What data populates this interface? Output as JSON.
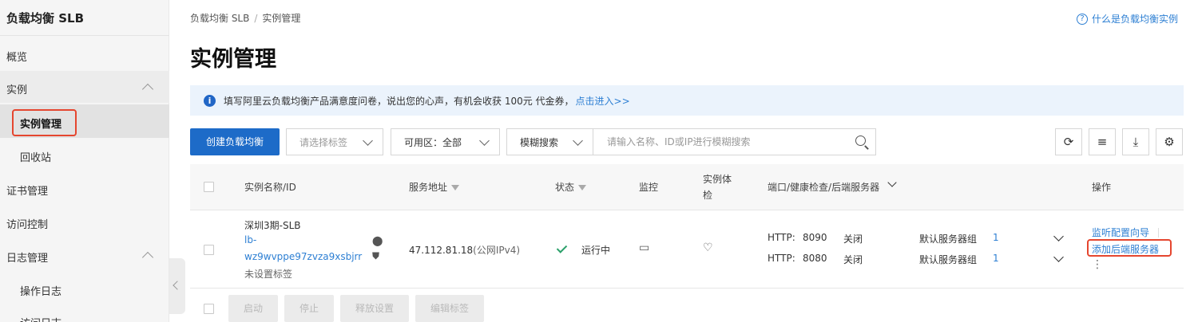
{
  "sidebar": {
    "title": "负载均衡 SLB",
    "items": {
      "overview": "概览",
      "instances": "实例",
      "instance_mgmt": "实例管理",
      "recycle": "回收站",
      "certs": "证书管理",
      "access": "访问控制",
      "logs": "日志管理",
      "op_logs": "操作日志",
      "access_logs": "访问日志"
    }
  },
  "breadcrumb": {
    "root": "负载均衡 SLB",
    "sep": "/",
    "current": "实例管理"
  },
  "help_link": {
    "icon": "?",
    "label": "什么是负载均衡实例"
  },
  "page_title": "实例管理",
  "notice": {
    "icon": "i",
    "text": "填写阿里云负载均衡产品满意度问卷，说出您的心声，有机会收获 100元 代金券，",
    "link": "点击进入>>"
  },
  "toolbar": {
    "create_label": "创建负载均衡",
    "tag_placeholder": "请选择标签",
    "zone_label": "可用区：",
    "zone_value": "全部",
    "search_mode": "模糊搜索",
    "search_placeholder": "请输入名称、ID或IP进行模糊搜索",
    "refresh_icon": "⟳",
    "list_icon": "≡",
    "download_icon": "⤓",
    "settings_icon": "⚙"
  },
  "table": {
    "headers": {
      "name": "实例名称/ID",
      "address": "服务地址",
      "status": "状态",
      "monitor": "监控",
      "health1": "实例体",
      "health2": "检",
      "ports": "端口/健康检查/后端服务器",
      "actions": "操作"
    },
    "row": {
      "name": "深圳3期-SLB",
      "id_line1": "lb-",
      "id_line2": "wz9wvppe97zvza9xsbjrr",
      "tag": "未设置标签",
      "address": "47.112.81.18",
      "address_type": "(公网IPv4)",
      "status": "运行中",
      "listeners": [
        {
          "proto": "HTTP:",
          "port": "8090",
          "health": "关闭",
          "group": "默认服务器组",
          "count": "1"
        },
        {
          "proto": "HTTP:",
          "port": "8080",
          "health": "关闭",
          "group": "默认服务器组",
          "count": "1"
        }
      ],
      "action_wizard": "监听配置向导",
      "action_add_backend": "添加后端服务器",
      "action_more": "⋮"
    },
    "bulk": {
      "start": "启动",
      "stop": "停止",
      "release": "释放设置",
      "edit_tags": "编辑标签"
    }
  },
  "colors": {
    "primary": "#1d6bc8",
    "link": "#2d7fd3",
    "highlight": "#e5462f",
    "success": "#2ba06a"
  }
}
